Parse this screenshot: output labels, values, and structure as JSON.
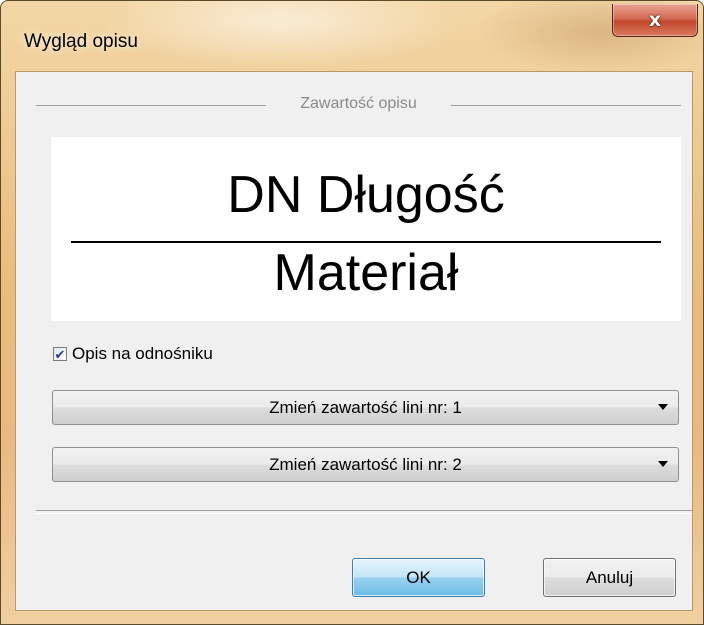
{
  "window": {
    "title": "Wygląd opisu",
    "close_glyph": "x"
  },
  "group": {
    "label": "Zawartość opisu"
  },
  "preview": {
    "line1": "DN Długość",
    "line2": "Materiał"
  },
  "checkbox": {
    "label": "Opis na odnośniku",
    "checked": true,
    "check_glyph": "✔"
  },
  "combos": [
    {
      "label": "Zmień zawartość lini nr: 1",
      "icon": "chevron-down-icon"
    },
    {
      "label": "Zmień zawartość lini nr: 2",
      "icon": "chevron-down-icon"
    }
  ],
  "buttons": {
    "ok_label": "OK",
    "cancel_label": "Anuluj"
  },
  "colors": {
    "title_bar": "#e9bd7d",
    "close_button": "#c2482d",
    "client_background": "#f0f0f0",
    "default_button": "#98d1ef"
  }
}
